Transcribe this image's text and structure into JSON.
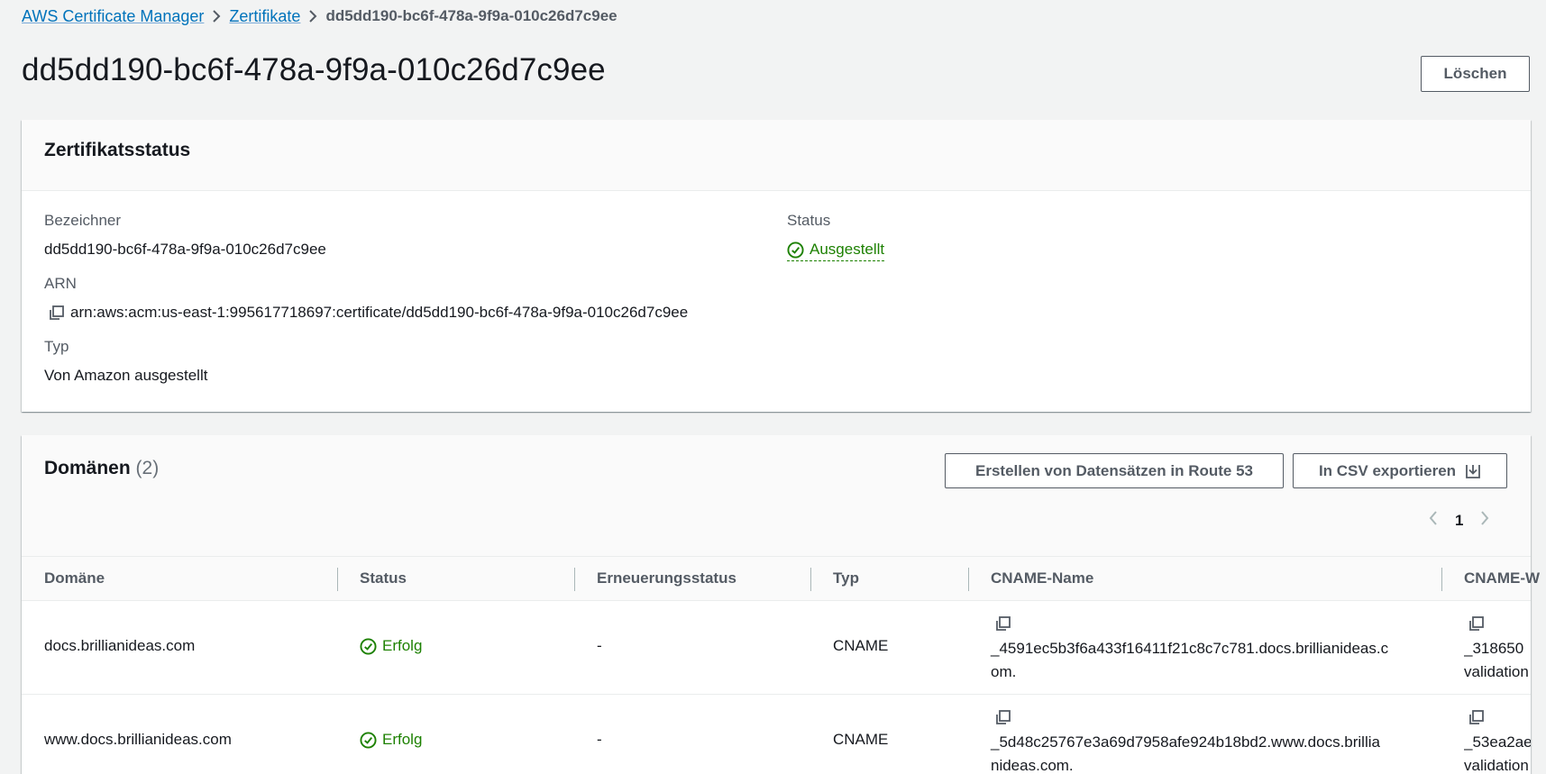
{
  "breadcrumb": {
    "items": [
      "AWS Certificate Manager",
      "Zertifikate"
    ],
    "current": "dd5dd190-bc6f-478a-9f9a-010c26d7c9ee"
  },
  "page": {
    "title": "dd5dd190-bc6f-478a-9f9a-010c26d7c9ee",
    "delete_label": "Löschen"
  },
  "status_panel": {
    "title": "Zertifikatsstatus",
    "identifier_label": "Bezeichner",
    "identifier_value": "dd5dd190-bc6f-478a-9f9a-010c26d7c9ee",
    "arn_label": "ARN",
    "arn_value": "arn:aws:acm:us-east-1:995617718697:certificate/dd5dd190-bc6f-478a-9f9a-010c26d7c9ee",
    "type_label": "Typ",
    "type_value": "Von Amazon ausgestellt",
    "status_label": "Status",
    "status_value": "Ausgestellt"
  },
  "domains_panel": {
    "title": "Domänen",
    "count": "(2)",
    "route53_label": "Erstellen von Datensätzen in Route 53",
    "csv_label": "In CSV exportieren",
    "page_number": "1",
    "columns": [
      "Domäne",
      "Status",
      "Erneuerungsstatus",
      "Typ",
      "CNAME-Name",
      "CNAME-W"
    ],
    "rows": [
      {
        "domain": "docs.brillianideas.com",
        "status": "Erfolg",
        "renewal": "-",
        "type": "CNAME",
        "cname_line1": "_4591ec5b3f6a433f16411f21c8c7c781.docs.brillianideas.c",
        "cname_line2": "om.",
        "cval_line1": "_318650",
        "cval_line2": "validation"
      },
      {
        "domain": "www.docs.brillianideas.com",
        "status": "Erfolg",
        "renewal": "-",
        "type": "CNAME",
        "cname_line1": "_5d48c25767e3a69d7958afe924b18bd2.www.docs.brillia",
        "cname_line2": "nideas.com.",
        "cval_line1": "_53ea2ae",
        "cval_line2": "validation"
      }
    ]
  },
  "colors": {
    "link": "#0073bb",
    "success": "#1d8102",
    "background": "#f2f3f3"
  }
}
